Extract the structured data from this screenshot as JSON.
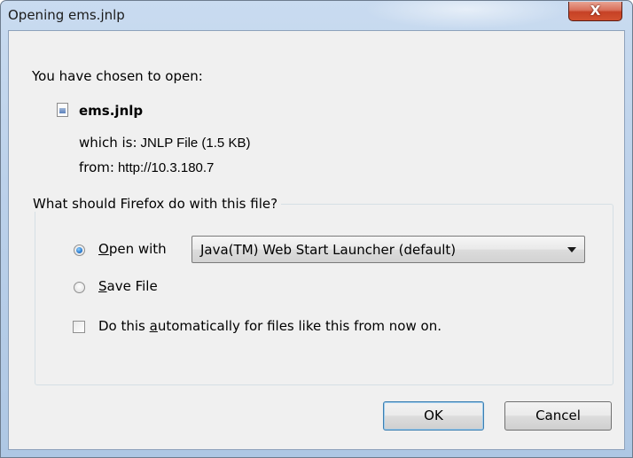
{
  "window": {
    "title": "Opening ems.jnlp",
    "close_glyph": "X"
  },
  "file_info": {
    "chosen_label": "You have chosen to open:",
    "file_icon": "document-icon",
    "file_name": "ems.jnlp",
    "which_is_label": "which is:",
    "which_is_value": "JNLP File (1.5 KB)",
    "from_label": "from:",
    "from_value": "http://10.3.180.7"
  },
  "action_group": {
    "legend": "What should Firefox do with this file?",
    "open_with": {
      "mnemonic": "O",
      "rest": "pen with",
      "checked": true
    },
    "open_with_app": {
      "selected": "Java(TM) Web Start Launcher (default)"
    },
    "save_file": {
      "mnemonic": "S",
      "rest": "ave File",
      "checked": false
    },
    "auto_checkbox": {
      "prefix": "Do this ",
      "mnemonic": "a",
      "suffix": "utomatically for files like this from now on.",
      "checked": false
    }
  },
  "buttons": {
    "ok": "OK",
    "cancel": "Cancel"
  }
}
